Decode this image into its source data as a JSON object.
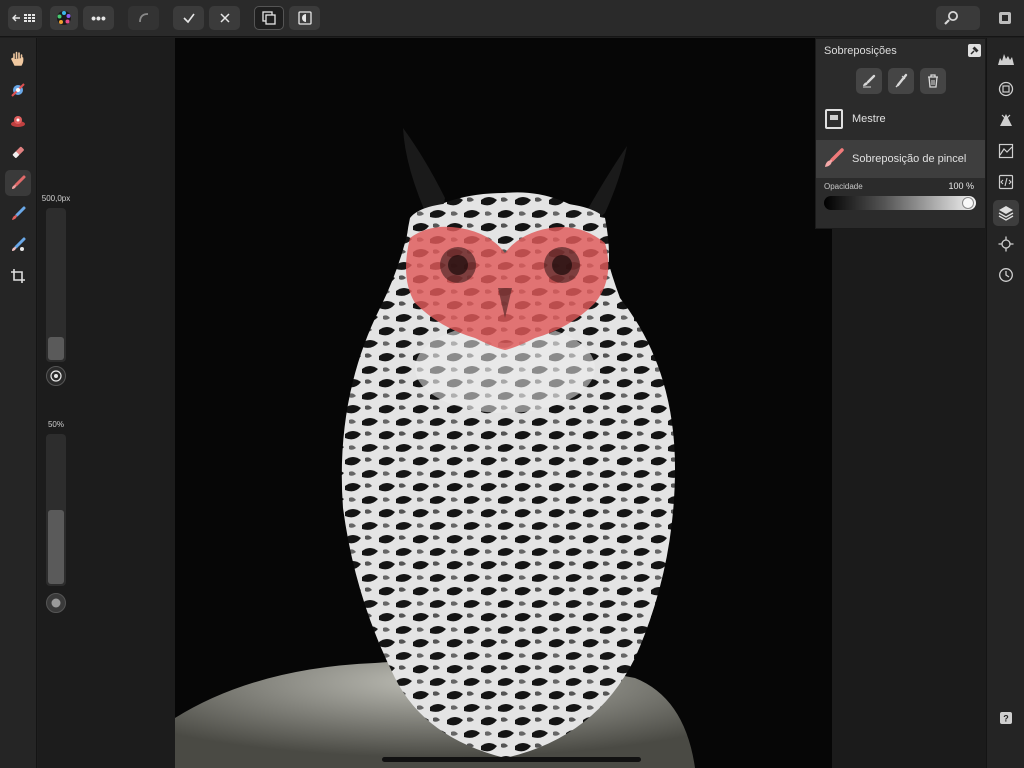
{
  "toolbar": {
    "back_icon": "back-arrow-grid-icon",
    "persona_icon": "photo-persona-icon",
    "more_label": "•••",
    "commit_icon": "checkmark-icon",
    "cancel_icon": "close-icon"
  },
  "left_tools": [
    {
      "name": "hand-tool",
      "icon": "hand-icon"
    },
    {
      "name": "overlay-gradient-tool",
      "icon": "gradient-overlay-icon"
    },
    {
      "name": "overlay-radial-tool",
      "icon": "radial-overlay-icon"
    },
    {
      "name": "overlay-erase-tool",
      "icon": "eraser-icon"
    },
    {
      "name": "overlay-paint-tool",
      "icon": "paint-brush-icon",
      "active": true
    },
    {
      "name": "overlay-erase-brush-tool",
      "icon": "erase-brush-icon"
    },
    {
      "name": "overlay-clone-tool",
      "icon": "clone-brush-icon"
    },
    {
      "name": "crop-tool",
      "icon": "crop-icon"
    }
  ],
  "context": {
    "brush_size_label": "500,0px",
    "brush_size_level": 0.15,
    "hardness_label": "50%",
    "hardness_level": 0.5
  },
  "overlays_panel": {
    "title": "Sobreposições",
    "items": [
      {
        "label": "Mestre",
        "icon": "master-layer-icon"
      },
      {
        "label": "Sobreposição de pincel",
        "icon": "brush-overlay-icon",
        "selected": true
      }
    ],
    "opacity_label": "Opacidade",
    "opacity_value": "100 %",
    "opacity_level": 1.0
  },
  "right_tools": [
    {
      "name": "histogram-studio",
      "icon": "histogram-icon"
    },
    {
      "name": "navigator-studio",
      "icon": "navigator-icon"
    },
    {
      "name": "info-studio",
      "icon": "info-icon"
    },
    {
      "name": "scope-studio",
      "icon": "scope-icon"
    },
    {
      "name": "presets-studio",
      "icon": "presets-icon"
    },
    {
      "name": "overlays-studio",
      "icon": "layers-icon",
      "active": true
    },
    {
      "name": "transform-studio",
      "icon": "transform-icon"
    },
    {
      "name": "history-studio",
      "icon": "history-icon"
    },
    {
      "name": "help-button",
      "icon": "help-icon"
    }
  ],
  "colors": {
    "accent_red": "#e05a5a",
    "panel_bg": "#2b2b2b",
    "toolbar_bg": "#2a2a2a"
  }
}
